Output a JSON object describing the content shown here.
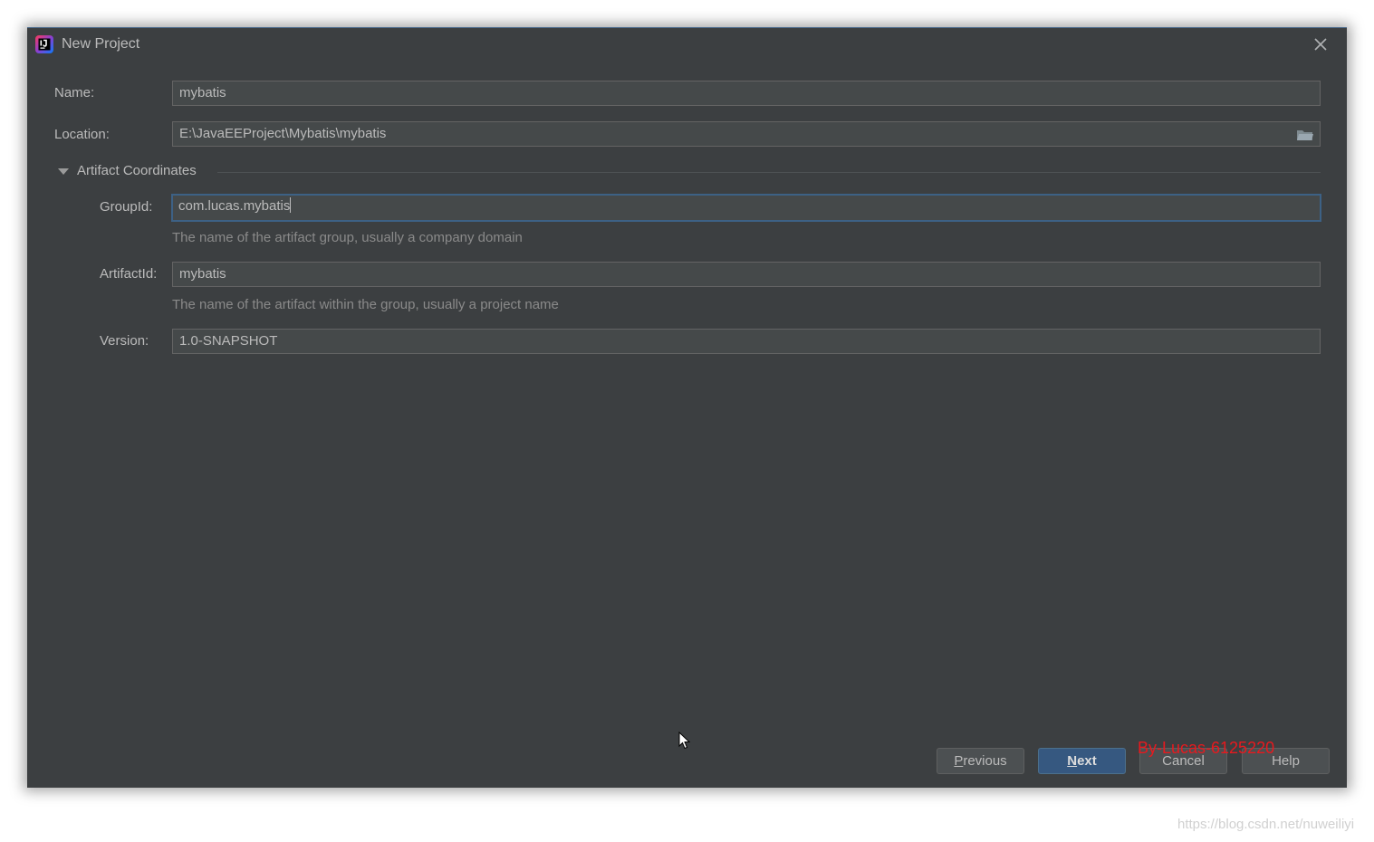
{
  "dialog": {
    "title": "New Project",
    "app_icon": "intellij-idea-icon",
    "close_icon": "close-icon"
  },
  "form": {
    "name_label": "Name:",
    "name_value": "mybatis",
    "location_label": "Location:",
    "location_value": "E:\\JavaEEProject\\Mybatis\\mybatis",
    "browse_icon": "folder-icon"
  },
  "artifact": {
    "section_title": "Artifact Coordinates",
    "group_label": "GroupId:",
    "group_value": "com.lucas.mybatis",
    "group_hint": "The name of the artifact group, usually a company domain",
    "artifact_label": "ArtifactId:",
    "artifact_value": "mybatis",
    "artifact_hint": "The name of the artifact within the group, usually a project name",
    "version_label": "Version:",
    "version_value": "1.0-SNAPSHOT"
  },
  "buttons": {
    "previous_mnemonic": "P",
    "previous_rest": "revious",
    "next_mnemonic": "N",
    "next_rest": "ext",
    "cancel": "Cancel",
    "help": "Help"
  },
  "watermarks": {
    "overlay": "By-Lucas-6125220",
    "url": "https://blog.csdn.net/nuweiliyi"
  },
  "colors": {
    "dialog_bg": "#3c3f41",
    "field_bg": "#45494a",
    "focus_border": "#3d6185",
    "default_button": "#365880",
    "watermark": "#e8191e"
  }
}
